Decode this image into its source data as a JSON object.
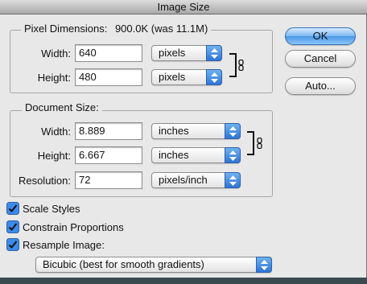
{
  "window": {
    "title": "Image Size"
  },
  "pixel_dimensions": {
    "legend": "Pixel Dimensions:",
    "summary": "900.0K (was 11.1M)",
    "width_label": "Width:",
    "width_value": "640",
    "width_unit": "pixels",
    "height_label": "Height:",
    "height_value": "480",
    "height_unit": "pixels"
  },
  "document_size": {
    "legend": "Document Size:",
    "width_label": "Width:",
    "width_value": "8.889",
    "width_unit": "inches",
    "height_label": "Height:",
    "height_value": "6.667",
    "height_unit": "inches",
    "resolution_label": "Resolution:",
    "resolution_value": "72",
    "resolution_unit": "pixels/inch"
  },
  "options": {
    "scale_styles": {
      "label": "Scale Styles",
      "checked": true
    },
    "constrain_proportions": {
      "label": "Constrain Proportions",
      "checked": true
    },
    "resample_image": {
      "label": "Resample Image:",
      "checked": true
    },
    "resample_method": "Bicubic (best for smooth gradients)"
  },
  "buttons": {
    "ok": "OK",
    "cancel": "Cancel",
    "auto": "Auto..."
  },
  "icons": {
    "chain": "chain-link-icon",
    "popup_arrows": "popup-arrows-icon",
    "checkbox": "checkbox-checked-icon"
  },
  "colors": {
    "accent_blue": "#3d8be8",
    "dialog_bg": "#e8e8e8"
  }
}
